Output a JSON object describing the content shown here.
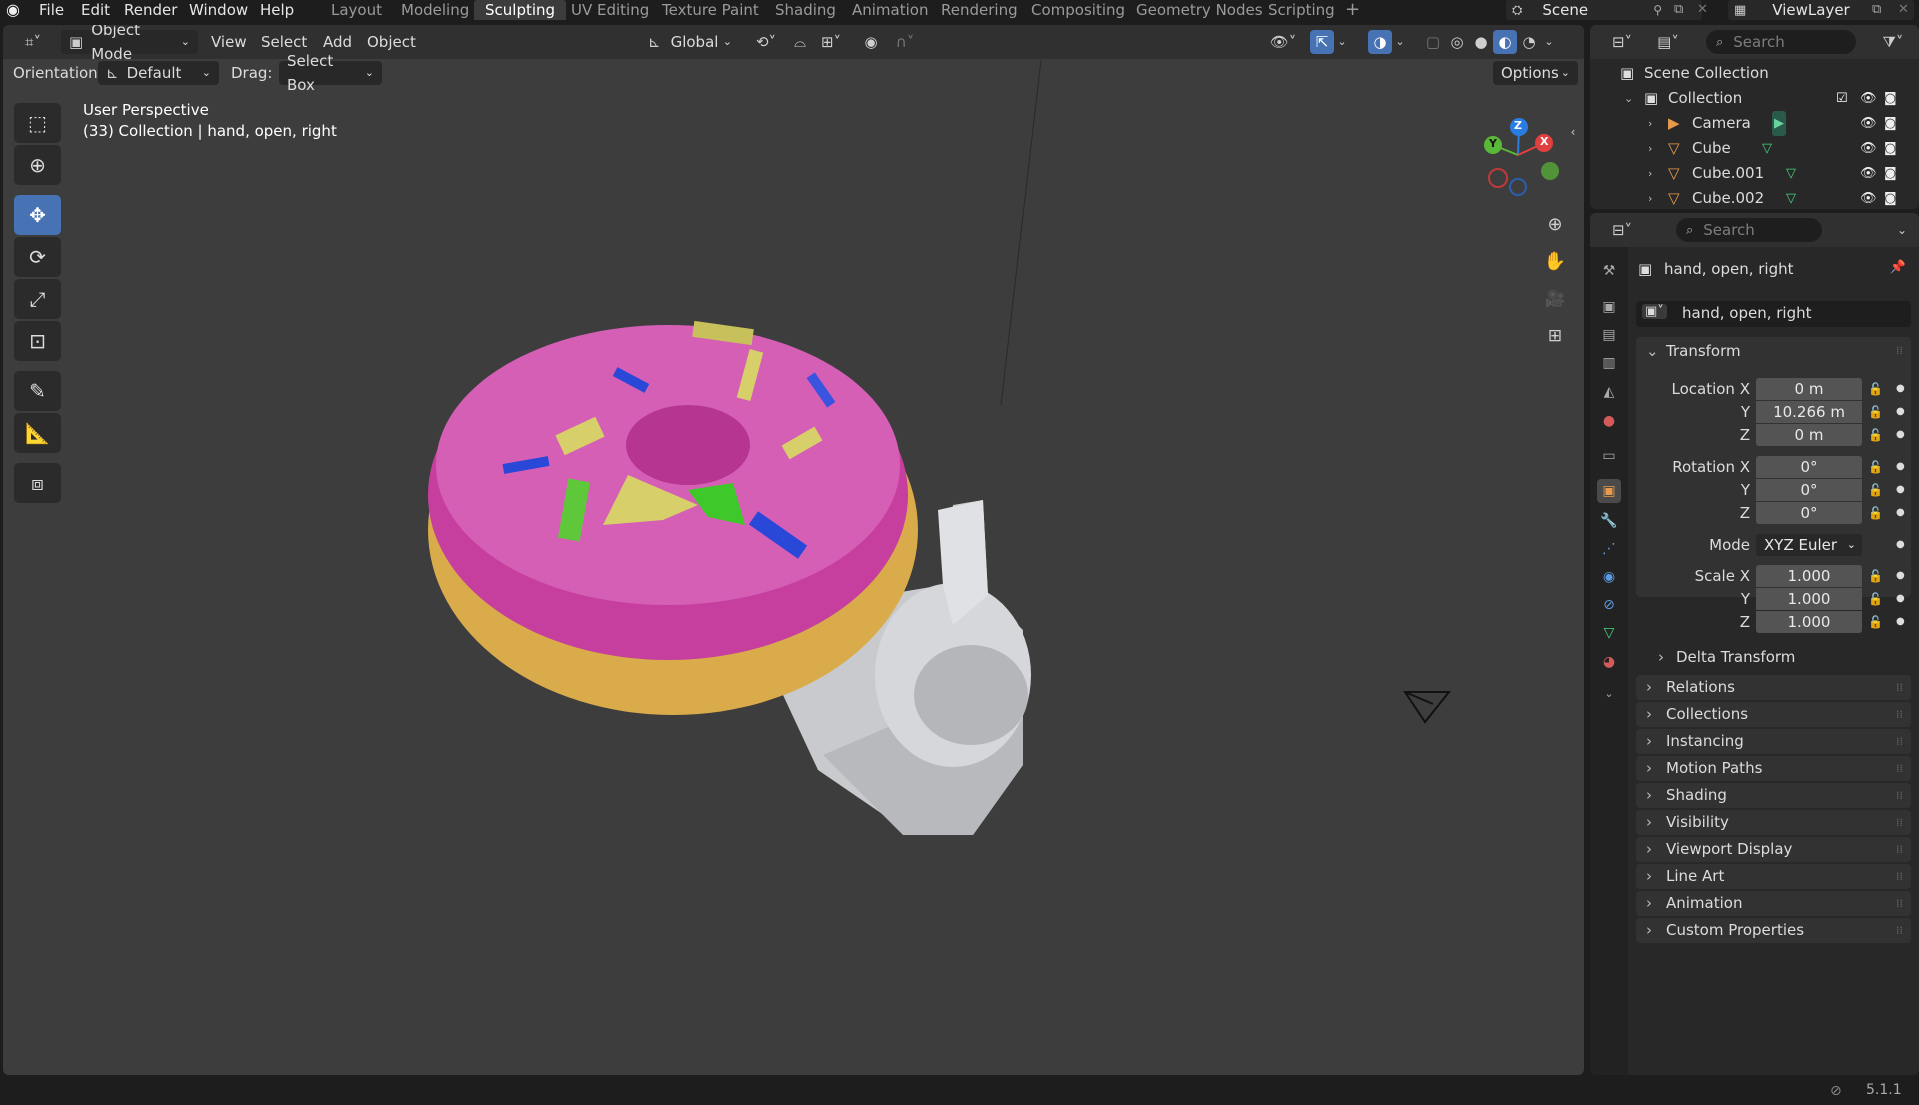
{
  "topbar": {
    "menus": [
      "File",
      "Edit",
      "Render",
      "Window",
      "Help"
    ],
    "workspaces": [
      "Layout",
      "Modeling",
      "Sculpting",
      "UV Editing",
      "Texture Paint",
      "Shading",
      "Animation",
      "Rendering",
      "Compositing",
      "Geometry Nodes",
      "Scripting"
    ],
    "active_workspace": "Sculpting",
    "add_tab": "+",
    "scene": "Scene",
    "view_layer": "ViewLayer"
  },
  "viewport": {
    "mode": "Object Mode",
    "menus": [
      "View",
      "Select",
      "Add",
      "Object"
    ],
    "transform_orientation": "Global",
    "orientation_label": "Orientation:",
    "orientation_value": "Default",
    "drag_label": "Drag:",
    "drag_value": "Select Box",
    "options": "Options",
    "overlay_title": "User Perspective",
    "overlay_subtitle": "(33) Collection | hand, open, right",
    "gizmo": {
      "x": "X",
      "y": "Y",
      "z": "Z"
    }
  },
  "outliner": {
    "search_placeholder": "Search",
    "scene_collection": "Scene Collection",
    "collection": "Collection",
    "items": [
      "Camera",
      "Cube",
      "Cube.001",
      "Cube.002"
    ]
  },
  "properties": {
    "search_placeholder": "Search",
    "object_name": "hand, open, right",
    "datablock_name": "hand, open, right",
    "transform_title": "Transform",
    "location": {
      "label": "Location X",
      "x": "0 m",
      "y": "10.266 m",
      "z": "0 m"
    },
    "rotation": {
      "label": "Rotation X",
      "x": "0°",
      "y": "0°",
      "z": "0°"
    },
    "mode_label": "Mode",
    "mode_value": "XYZ Euler",
    "scale": {
      "label": "Scale X",
      "x": "1.000",
      "y": "1.000",
      "z": "1.000"
    },
    "axis_y": "Y",
    "axis_z": "Z",
    "delta_transform": "Delta Transform",
    "panels": [
      "Relations",
      "Collections",
      "Instancing",
      "Motion Paths",
      "Shading",
      "Visibility",
      "Viewport Display",
      "Line Art",
      "Animation",
      "Custom Properties"
    ]
  },
  "statusbar": {
    "version": "5.1.1"
  }
}
